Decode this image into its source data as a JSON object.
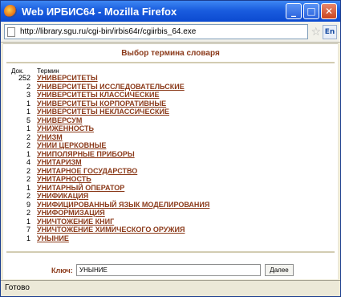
{
  "window": {
    "title": "Web ИРБИС64 - Mozilla Firefox"
  },
  "urlbar": {
    "url": "http://library.sgu.ru/cgi-bin/irbis64r/cgiirbis_64.exe",
    "lang_badge": "En"
  },
  "page": {
    "heading": "Выбор термина словаря",
    "col_count": "Док.",
    "col_term": "Термин",
    "rows": [
      {
        "count": "252",
        "term": "УНИВЕРСИТЕТЫ"
      },
      {
        "count": "2",
        "term": "УНИВЕРСИТЕТЫ ИССЛЕДОВАТЕЛЬСКИЕ"
      },
      {
        "count": "3",
        "term": "УНИВЕРСИТЕТЫ КЛАССИЧЕСКИЕ"
      },
      {
        "count": "1",
        "term": "УНИВЕРСИТЕТЫ КОРПОРАТИВНЫЕ"
      },
      {
        "count": "1",
        "term": "УНИВЕРСИТЕТЫ НЕКЛАССИЧЕСКИЕ"
      },
      {
        "count": "5",
        "term": "УНИВЕРСУМ"
      },
      {
        "count": "1",
        "term": "УНИЖЕННОСТЬ"
      },
      {
        "count": "2",
        "term": "УНИЗМ"
      },
      {
        "count": "2",
        "term": "УНИИ ЦЕРКОВНЫЕ"
      },
      {
        "count": "1",
        "term": "УНИПОЛЯРНЫЕ ПРИБОРЫ"
      },
      {
        "count": "4",
        "term": "УНИТАРИЗМ"
      },
      {
        "count": "2",
        "term": "УНИТАРНОЕ ГОСУДАРСТВО"
      },
      {
        "count": "2",
        "term": "УНИТАРНОСТЬ"
      },
      {
        "count": "1",
        "term": "УНИТАРНЫЙ ОПЕРАТОР"
      },
      {
        "count": "2",
        "term": "УНИФИКАЦИЯ"
      },
      {
        "count": "9",
        "term": "УНИФИЦИРОВАННЫЙ ЯЗЫК МОДЕЛИРОВАНИЯ"
      },
      {
        "count": "2",
        "term": "УНИФОРМИЗАЦИЯ"
      },
      {
        "count": "1",
        "term": "УНИЧТОЖЕНИЕ КНИГ"
      },
      {
        "count": "7",
        "term": "УНИЧТОЖЕНИЕ ХИМИЧЕСКОГО ОРУЖИЯ"
      },
      {
        "count": "1",
        "term": "УНЫНИЕ"
      }
    ],
    "key_label": "Ключ:",
    "key_value": "УНЫНИЕ",
    "next_label": "Далее"
  },
  "status": {
    "text": "Готово"
  }
}
